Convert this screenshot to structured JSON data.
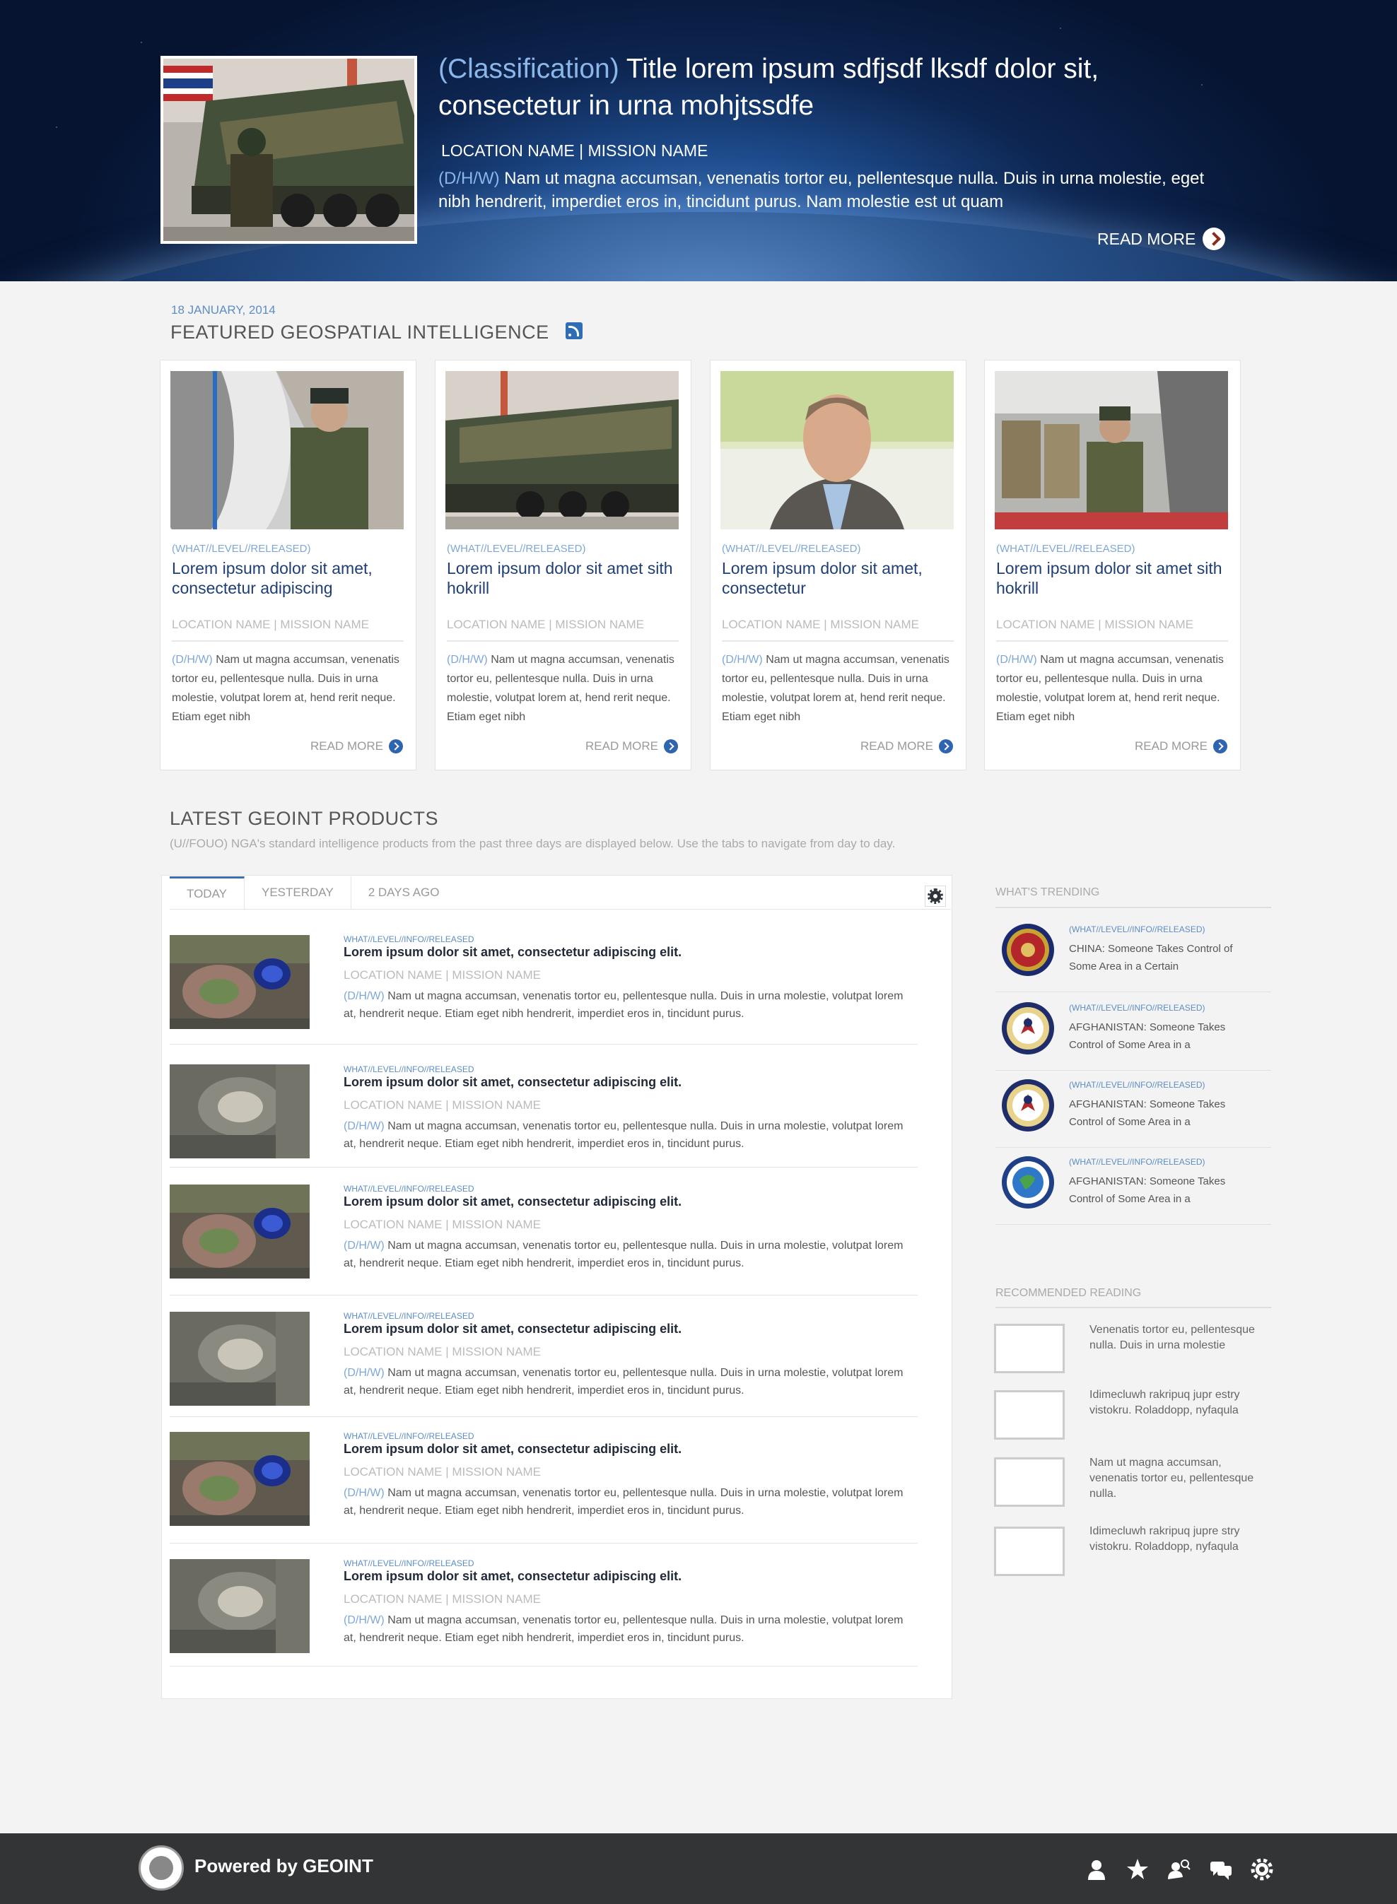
{
  "hero": {
    "classification": "(Classification)",
    "title": " Title lorem ipsum sdfjsdf lksdf dolor sit, consectetur in urna mohjtssdfe",
    "location": "LOCATION NAME | MISSION NAME",
    "dhw": "(D/H/W)",
    "description": " Nam ut magna accumsan, venenatis tortor eu, pellentesque nulla. Duis in urna molestie, eget nibh hendrerit, imperdiet eros in, tincidunt purus.  Nam molestie est ut quam",
    "read_more": "READ MORE"
  },
  "featured": {
    "date": "18 JANUARY, 2014",
    "title": "FEATURED GEOSPATIAL INTELLIGENCE",
    "cards": [
      {
        "tag": "(WHAT//LEVEL//RELEASED)",
        "title": "Lorem ipsum dolor sit amet, consectetur adipiscing",
        "location": "LOCATION NAME | MISSION NAME",
        "dhw": "(D/H/W)",
        "desc": " Nam ut magna accumsan, venenatis tortor eu, pellentesque nulla. Duis in urna molestie, volutpat lorem at, hend rerit neque. Etiam eget nibh",
        "more": "READ MORE"
      },
      {
        "tag": "(WHAT//LEVEL//RELEASED)",
        "title": "Lorem ipsum dolor sit amet sith hokrill",
        "location": "LOCATION NAME | MISSION NAME",
        "dhw": "(D/H/W)",
        "desc": " Nam ut magna accumsan, venenatis tortor eu, pellentesque nulla. Duis in urna molestie, volutpat lorem at, hend rerit neque. Etiam eget nibh",
        "more": "READ MORE"
      },
      {
        "tag": "(WHAT//LEVEL//RELEASED)",
        "title": "Lorem ipsum dolor sit amet, consectetur",
        "location": "LOCATION NAME | MISSION NAME",
        "dhw": "(D/H/W)",
        "desc": " Nam ut magna accumsan, venenatis tortor eu, pellentesque nulla. Duis in urna molestie, volutpat lorem at, hend rerit neque. Etiam eget nibh",
        "more": "READ MORE"
      },
      {
        "tag": "(WHAT//LEVEL//RELEASED)",
        "title": "Lorem ipsum dolor sit amet sith hokrill",
        "location": "LOCATION NAME | MISSION NAME",
        "dhw": "(D/H/W)",
        "desc": " Nam ut magna accumsan, venenatis tortor eu, pellentesque nulla. Duis in urna molestie, volutpat lorem at, hend rerit neque. Etiam eget nibh",
        "more": "READ MORE"
      }
    ]
  },
  "latest": {
    "title": "LATEST GEOINT PRODUCTS",
    "subtitle": "(U//FOUO) NGA's standard intelligence products from the past three days are displayed below. Use the tabs to navigate from day to day.",
    "tabs": [
      "TODAY",
      "YESTERDAY",
      "2 DAYS AGO"
    ],
    "products": [
      {
        "tag": "WHAT//LEVEL//INFO//RELEASED",
        "title": "Lorem ipsum dolor sit amet, consectetur adipiscing elit.",
        "location": "LOCATION NAME | MISSION NAME",
        "dhw": "(D/H/W)",
        "desc": " Nam ut magna accumsan, venenatis tortor eu, pellentesque nulla. Duis in urna molestie, volutpat lorem at, hendrerit neque. Etiam eget nibh hendrerit, imperdiet eros in, tincidunt purus."
      },
      {
        "tag": "WHAT//LEVEL//INFO//RELEASED",
        "title": "Lorem ipsum dolor sit amet, consectetur adipiscing elit.",
        "location": "LOCATION NAME | MISSION NAME",
        "dhw": "(D/H/W)",
        "desc": " Nam ut magna accumsan, venenatis tortor eu, pellentesque nulla. Duis in urna molestie, volutpat lorem at, hendrerit neque. Etiam eget nibh hendrerit, imperdiet eros in, tincidunt purus."
      },
      {
        "tag": "WHAT//LEVEL//INFO//RELEASED",
        "title": "Lorem ipsum dolor sit amet, consectetur adipiscing elit.",
        "location": "LOCATION NAME | MISSION NAME",
        "dhw": "(D/H/W)",
        "desc": " Nam ut magna accumsan, venenatis tortor eu, pellentesque nulla. Duis in urna molestie, volutpat lorem at, hendrerit neque. Etiam eget nibh hendrerit, imperdiet eros in, tincidunt purus."
      },
      {
        "tag": "WHAT//LEVEL//INFO//RELEASED",
        "title": "Lorem ipsum dolor sit amet, consectetur adipiscing elit.",
        "location": "LOCATION NAME | MISSION NAME",
        "dhw": "(D/H/W)",
        "desc": " Nam ut magna accumsan, venenatis tortor eu, pellentesque nulla. Duis in urna molestie, volutpat lorem at, hendrerit neque. Etiam eget nibh hendrerit, imperdiet eros in, tincidunt purus."
      },
      {
        "tag": "WHAT//LEVEL//INFO//RELEASED",
        "title": "Lorem ipsum dolor sit amet, consectetur adipiscing elit.",
        "location": "LOCATION NAME | MISSION NAME",
        "dhw": "(D/H/W)",
        "desc": " Nam ut magna accumsan, venenatis tortor eu, pellentesque nulla. Duis in urna molestie, volutpat lorem at, hendrerit neque. Etiam eget nibh hendrerit, imperdiet eros in, tincidunt purus."
      },
      {
        "tag": "WHAT//LEVEL//INFO//RELEASED",
        "title": "Lorem ipsum dolor sit amet, consectetur adipiscing elit.",
        "location": "LOCATION NAME | MISSION NAME",
        "dhw": "(D/H/W)",
        "desc": " Nam ut magna accumsan, venenatis tortor eu, pellentesque nulla. Duis in urna molestie, volutpat lorem at, hendrerit neque. Etiam eget nibh hendrerit, imperdiet eros in, tincidunt purus."
      }
    ]
  },
  "sidebar": {
    "trending_title": "WHAT'S TRENDING",
    "trending": [
      {
        "tag": "(WHAT//LEVEL//INFO//RELEASED)",
        "text": "CHINA: Someone Takes Control of Some Area in a Certain",
        "seal": "marine-seal"
      },
      {
        "tag": "(WHAT//LEVEL//INFO//RELEASED)",
        "text": "AFGHANISTAN: Someone Takes Control of Some Area in a",
        "seal": "cia-seal"
      },
      {
        "tag": "(WHAT//LEVEL//INFO//RELEASED)",
        "text": "AFGHANISTAN: Someone Takes Control of Some Area in a",
        "seal": "cia-seal"
      },
      {
        "tag": "(WHAT//LEVEL//INFO//RELEASED)",
        "text": "AFGHANISTAN: Someone Takes Control of Some Area in a",
        "seal": "globe-seal"
      }
    ],
    "reading_title": "RECOMMENDED READING",
    "reading": [
      "Venenatis tortor eu, pellentesque nulla. Duis in urna molestie",
      "Idimecluwh rakripuq jupr estry vistokru. Roladdopp, nyfaqula",
      "Nam ut magna accumsan, venenatis tortor eu, pellentesque nulla.",
      "Idimecluwh rakripuq jupre stry vistokru. Roladdopp, nyfaqula"
    ]
  },
  "footer": {
    "powered": "Powered by GEOINT",
    "icons": [
      "user-icon",
      "star-icon",
      "user-search-icon",
      "chat-icon",
      "gear-icon"
    ]
  }
}
